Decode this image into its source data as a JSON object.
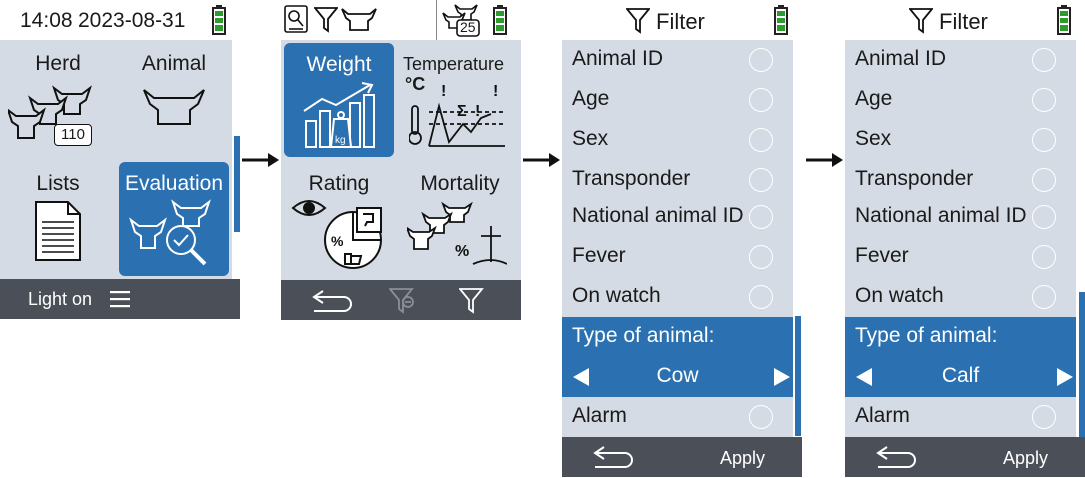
{
  "screen1": {
    "status": {
      "time": "14:08",
      "date": "2023-08-31"
    },
    "tiles": [
      {
        "label": "Herd",
        "badge": "110",
        "icon": "herd-icon"
      },
      {
        "label": "Animal",
        "icon": "cow-head-icon"
      },
      {
        "label": "Lists",
        "icon": "document-list-icon"
      },
      {
        "label": "Evaluation",
        "icon": "evaluation-icon",
        "selected": true
      }
    ],
    "bottom": {
      "left_label": "Light on",
      "menu_icon": "hamburger-menu-icon"
    }
  },
  "screen2": {
    "topbar": {
      "icons": [
        "search-settings-icon",
        "filter-icon",
        "cow-head-icon"
      ],
      "herd_badge": "25"
    },
    "tiles": [
      {
        "label": "Weight",
        "icon": "weight-chart-icon",
        "selected": true
      },
      {
        "label": "Temperature",
        "icon": "temperature-icon",
        "unit": "°C"
      },
      {
        "label": "Rating",
        "icon": "rating-icon"
      },
      {
        "label": "Mortality",
        "icon": "mortality-icon"
      }
    ],
    "bottom": {
      "icons": [
        "back-arrow-icon",
        "filter-remove-icon",
        "filter-icon"
      ]
    }
  },
  "screen3": {
    "title": "Filter",
    "items": [
      "Animal ID",
      "Age",
      "Sex",
      "Transponder",
      "National animal ID",
      "Fever",
      "On watch"
    ],
    "selector": {
      "label": "Type of animal:",
      "value": "Cow"
    },
    "after_item": "Alarm",
    "bottom": {
      "apply_label": "Apply"
    }
  },
  "screen4": {
    "title": "Filter",
    "items": [
      "Animal ID",
      "Age",
      "Sex",
      "Transponder",
      "National animal ID",
      "Fever",
      "On watch"
    ],
    "selector": {
      "label": "Type of animal:",
      "value": "Calf"
    },
    "after_item": "Alarm",
    "bottom": {
      "apply_label": "Apply"
    }
  },
  "colors": {
    "accent": "#2b70b0",
    "panel": "#d4dbe4",
    "bar": "#4b4f57",
    "battery": "#2e9b2e"
  }
}
